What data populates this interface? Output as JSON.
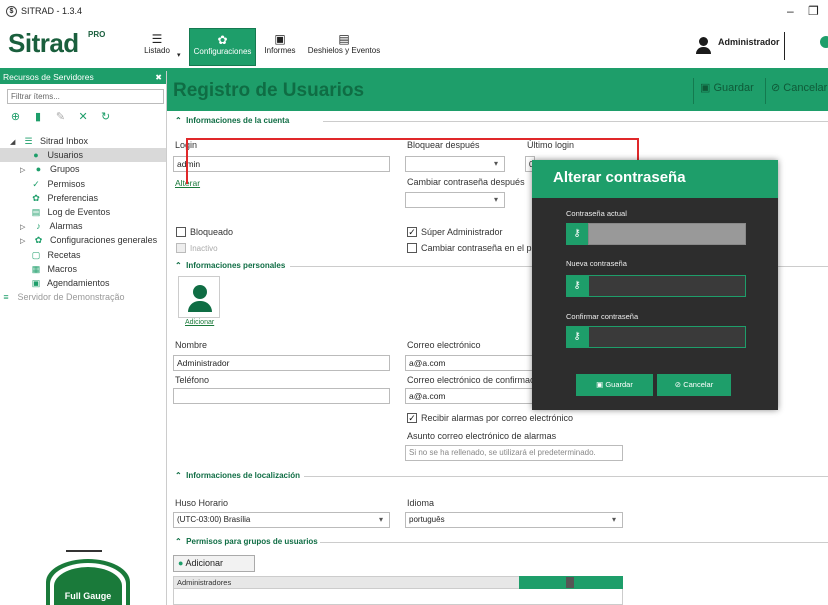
{
  "window": {
    "title": "SITRAD - 1.3.4",
    "app_icon": "$"
  },
  "ribbon": {
    "logo": "Sitrad",
    "logo_pro": "PRO",
    "listado": "Listado",
    "configuraciones": "Configuraciones",
    "informes": "Informes",
    "deshielos": "Deshielos y Eventos",
    "user": "Administrador",
    "accent": "#1e9e6a"
  },
  "sidebar": {
    "header": "Recursos de Servidores",
    "filter_placeholder": "Filtrar ítems...",
    "tree": [
      {
        "label": "Sitrad Inbox",
        "icon": "list-icon"
      },
      {
        "label": "Usuarios",
        "icon": "user-icon"
      },
      {
        "label": "Grupos",
        "icon": "users-icon"
      },
      {
        "label": "Permisos",
        "icon": "check-icon"
      },
      {
        "label": "Preferencias",
        "icon": "gear-icon"
      },
      {
        "label": "Log de Eventos",
        "icon": "document-icon"
      },
      {
        "label": "Alarmas",
        "icon": "bell-icon"
      },
      {
        "label": "Configuraciones generales",
        "icon": "gear-icon"
      },
      {
        "label": "Recetas",
        "icon": "clipboard-icon"
      },
      {
        "label": "Macros",
        "icon": "macro-icon"
      },
      {
        "label": "Agendamientos",
        "icon": "calendar-icon"
      },
      {
        "label": "Servidor de Demonstração",
        "icon": "server-icon"
      }
    ],
    "brand": "Full Gauge"
  },
  "main": {
    "title": "Registro de Usuarios",
    "save": "Guardar",
    "cancel": "Cancelar",
    "sections": {
      "account": "Informaciones de la cuenta",
      "personal": "Informaciones personales",
      "location": "Informaciones de localización",
      "group_perms": "Permisos para grupos de usuarios"
    },
    "login_label": "Login",
    "login_value": "admin",
    "change_link": "Alterar",
    "block_after_label": "Bloquear después",
    "last_login_label": "Último login",
    "last_login_value": "0",
    "change_pwd_after_label": "Cambiar contraseña después",
    "blocked_label": "Bloqueado",
    "inactive_label": "Inactivo",
    "super_admin_label": "Súper Administrador",
    "change_pwd_next_label": "Cambiar contraseña en el próx",
    "add_photo": "Adicionar",
    "name_label": "Nombre",
    "name_value": "Administrador",
    "phone_label": "Teléfono",
    "email_label": "Correo electrónico",
    "email_value": "a@a.com",
    "email_confirm_label": "Correo electrónico de confirmaci",
    "email_confirm_value": "a@a.com",
    "receive_alarms_label": "Recibir alarmas por correo electrónico",
    "alarm_subject_label": "Asunto correo electrónico de alarmas",
    "alarm_subject_placeholder": "Si no se ha rellenado, se utilizará el predeterminado.",
    "timezone_label": "Huso Horario",
    "timezone_value": "(UTC-03:00) Brasília",
    "language_label": "Idioma",
    "language_value": "português",
    "add_group": "Adicionar",
    "group_row": "Administradores"
  },
  "modal": {
    "title": "Alterar contraseña",
    "current_label": "Contraseña actual",
    "new_label": "Nueva contraseña",
    "confirm_label": "Confirmar contraseña",
    "save": "Guardar",
    "cancel": "Cancelar"
  }
}
